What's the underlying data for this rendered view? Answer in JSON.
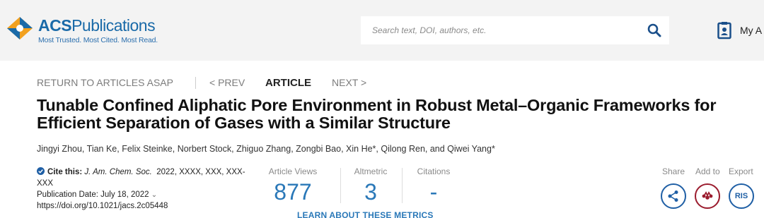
{
  "header": {
    "logo_name_bold": "ACS",
    "logo_name_light": "Publications",
    "logo_tagline": "Most Trusted. Most Cited. Most Read.",
    "search_placeholder": "Search text, DOI, authors, etc.",
    "my_account_label": "My A"
  },
  "nav": {
    "return_label": "RETURN TO ARTICLES ASAP",
    "prev_label": "< PREV",
    "article_label": "ARTICLE",
    "next_label": "NEXT >"
  },
  "article": {
    "title": "Tunable Confined Aliphatic Pore Environment in Robust Metal–Organic Frameworks for Efficient Separation of Gases with a Similar Structure",
    "authors": "Jingyi Zhou, Tian Ke, Felix Steinke, Norbert Stock, Zhiguo Zhang, Zongbi Bao, Xin He*, Qilong Ren, and Qiwei Yang*"
  },
  "citation": {
    "cite_label": "Cite this:",
    "journal": "J. Am. Chem. Soc.",
    "details": "2022, XXXX, XXX, XXX-",
    "details_cont": "XXX",
    "pub_date": "Publication Date: July 18, 2022",
    "doi": "https://doi.org/10.1021/jacs.2c05448"
  },
  "metrics": {
    "views_label": "Article Views",
    "views_value": "877",
    "altmetric_label": "Altmetric",
    "altmetric_value": "3",
    "citations_label": "Citations",
    "citations_value": "-",
    "learn_label": "LEARN ABOUT THESE METRICS"
  },
  "actions": {
    "share_label": "Share",
    "add_label": "Add to",
    "export_label": "Export",
    "ris_label": "RIS"
  },
  "colors": {
    "brand_blue": "#2a78b8",
    "header_bg": "#f3f3f3",
    "mendeley_red": "#9b1c2e"
  },
  "icons": {
    "logo": "acs-hexagon-logo-icon",
    "search": "search-icon",
    "account": "clipboard-user-icon",
    "check": "check-circle-icon",
    "share": "share-icon",
    "mendeley": "mendeley-icon"
  }
}
